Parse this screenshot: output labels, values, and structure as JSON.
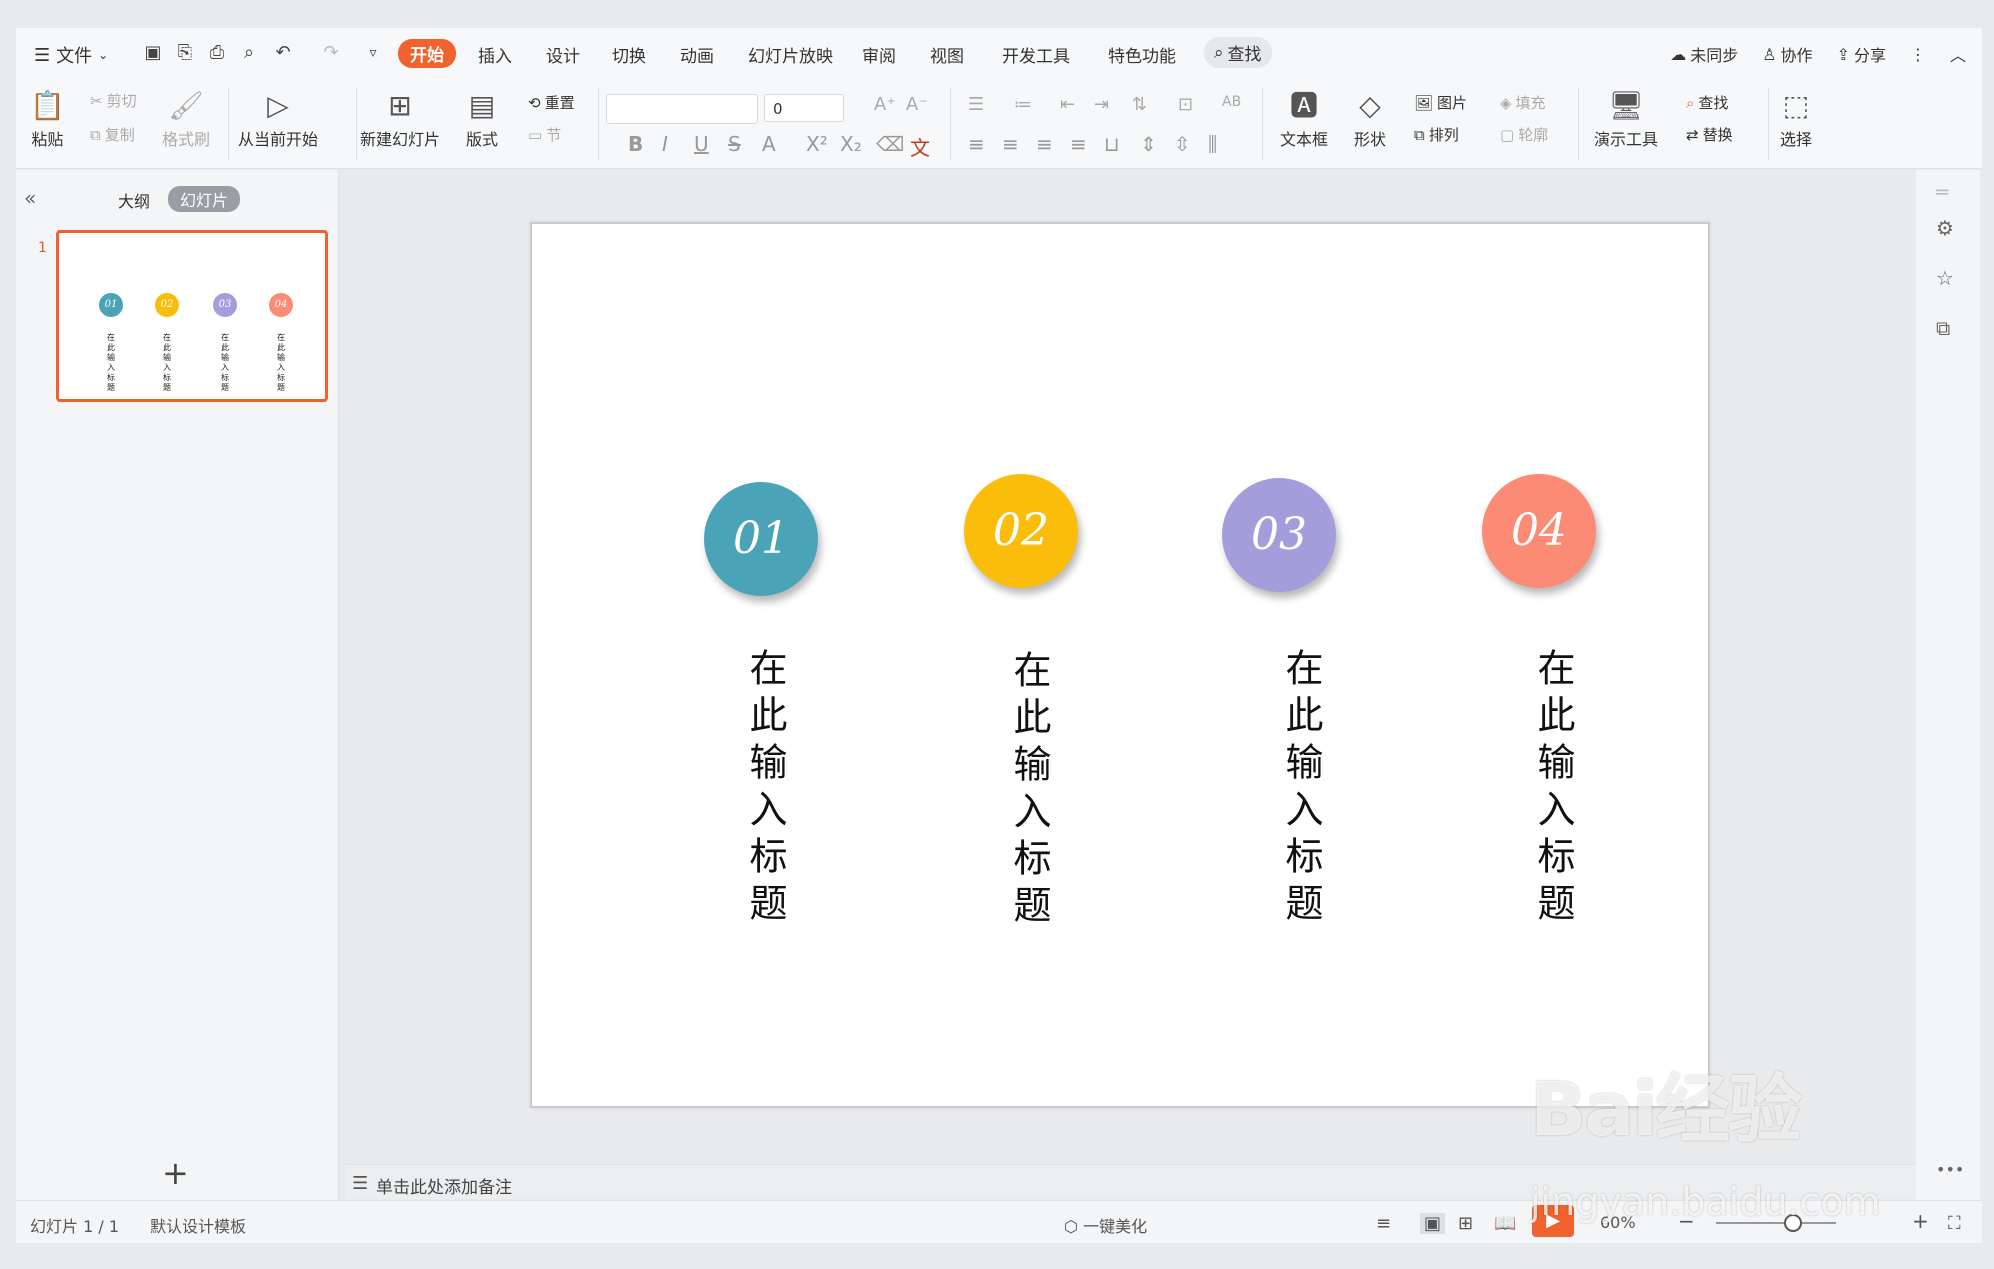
{
  "menu": {
    "file_label": "文件"
  },
  "tabs": [
    "开始",
    "插入",
    "设计",
    "切换",
    "动画",
    "幻灯片放映",
    "审阅",
    "视图",
    "开发工具",
    "特色功能"
  ],
  "search_tab": "查找",
  "right_tools": {
    "sync": "未同步",
    "collab": "协作",
    "share": "分享"
  },
  "ribbon": {
    "paste": "粘贴",
    "cut": "剪切",
    "copy": "复制",
    "format_painter": "格式刷",
    "from_current": "从当前开始",
    "new_slide": "新建幻灯片",
    "layout": "版式",
    "reset": "重置",
    "section": "节",
    "font_size": "0",
    "textbox": "文本框",
    "shape": "形状",
    "picture": "图片",
    "fill": "填充",
    "arrange": "排列",
    "outline": "轮廓",
    "presenter_tools": "演示工具",
    "find": "查找",
    "replace": "替换",
    "select": "选择"
  },
  "panel": {
    "outline_tab": "大纲",
    "slides_tab": "幻灯片",
    "slide_number": "1"
  },
  "slide": {
    "items": [
      {
        "num": "01",
        "color": "#4ba3b8",
        "title": "在此输入标题"
      },
      {
        "num": "02",
        "color": "#fbbd0c",
        "title": "在此输入标题"
      },
      {
        "num": "03",
        "color": "#a39edb",
        "title": "在此输入标题"
      },
      {
        "num": "04",
        "color": "#fb8b74",
        "title": "在此输入标题"
      }
    ]
  },
  "notes_placeholder": "单击此处添加备注",
  "status": {
    "slide_count": "幻灯片 1 / 1",
    "template": "默认设计模板",
    "beautify": "一键美化",
    "zoom": "60%"
  },
  "watermark": {
    "brand": "Bai经验",
    "url": "jingyan.baidu.com"
  }
}
